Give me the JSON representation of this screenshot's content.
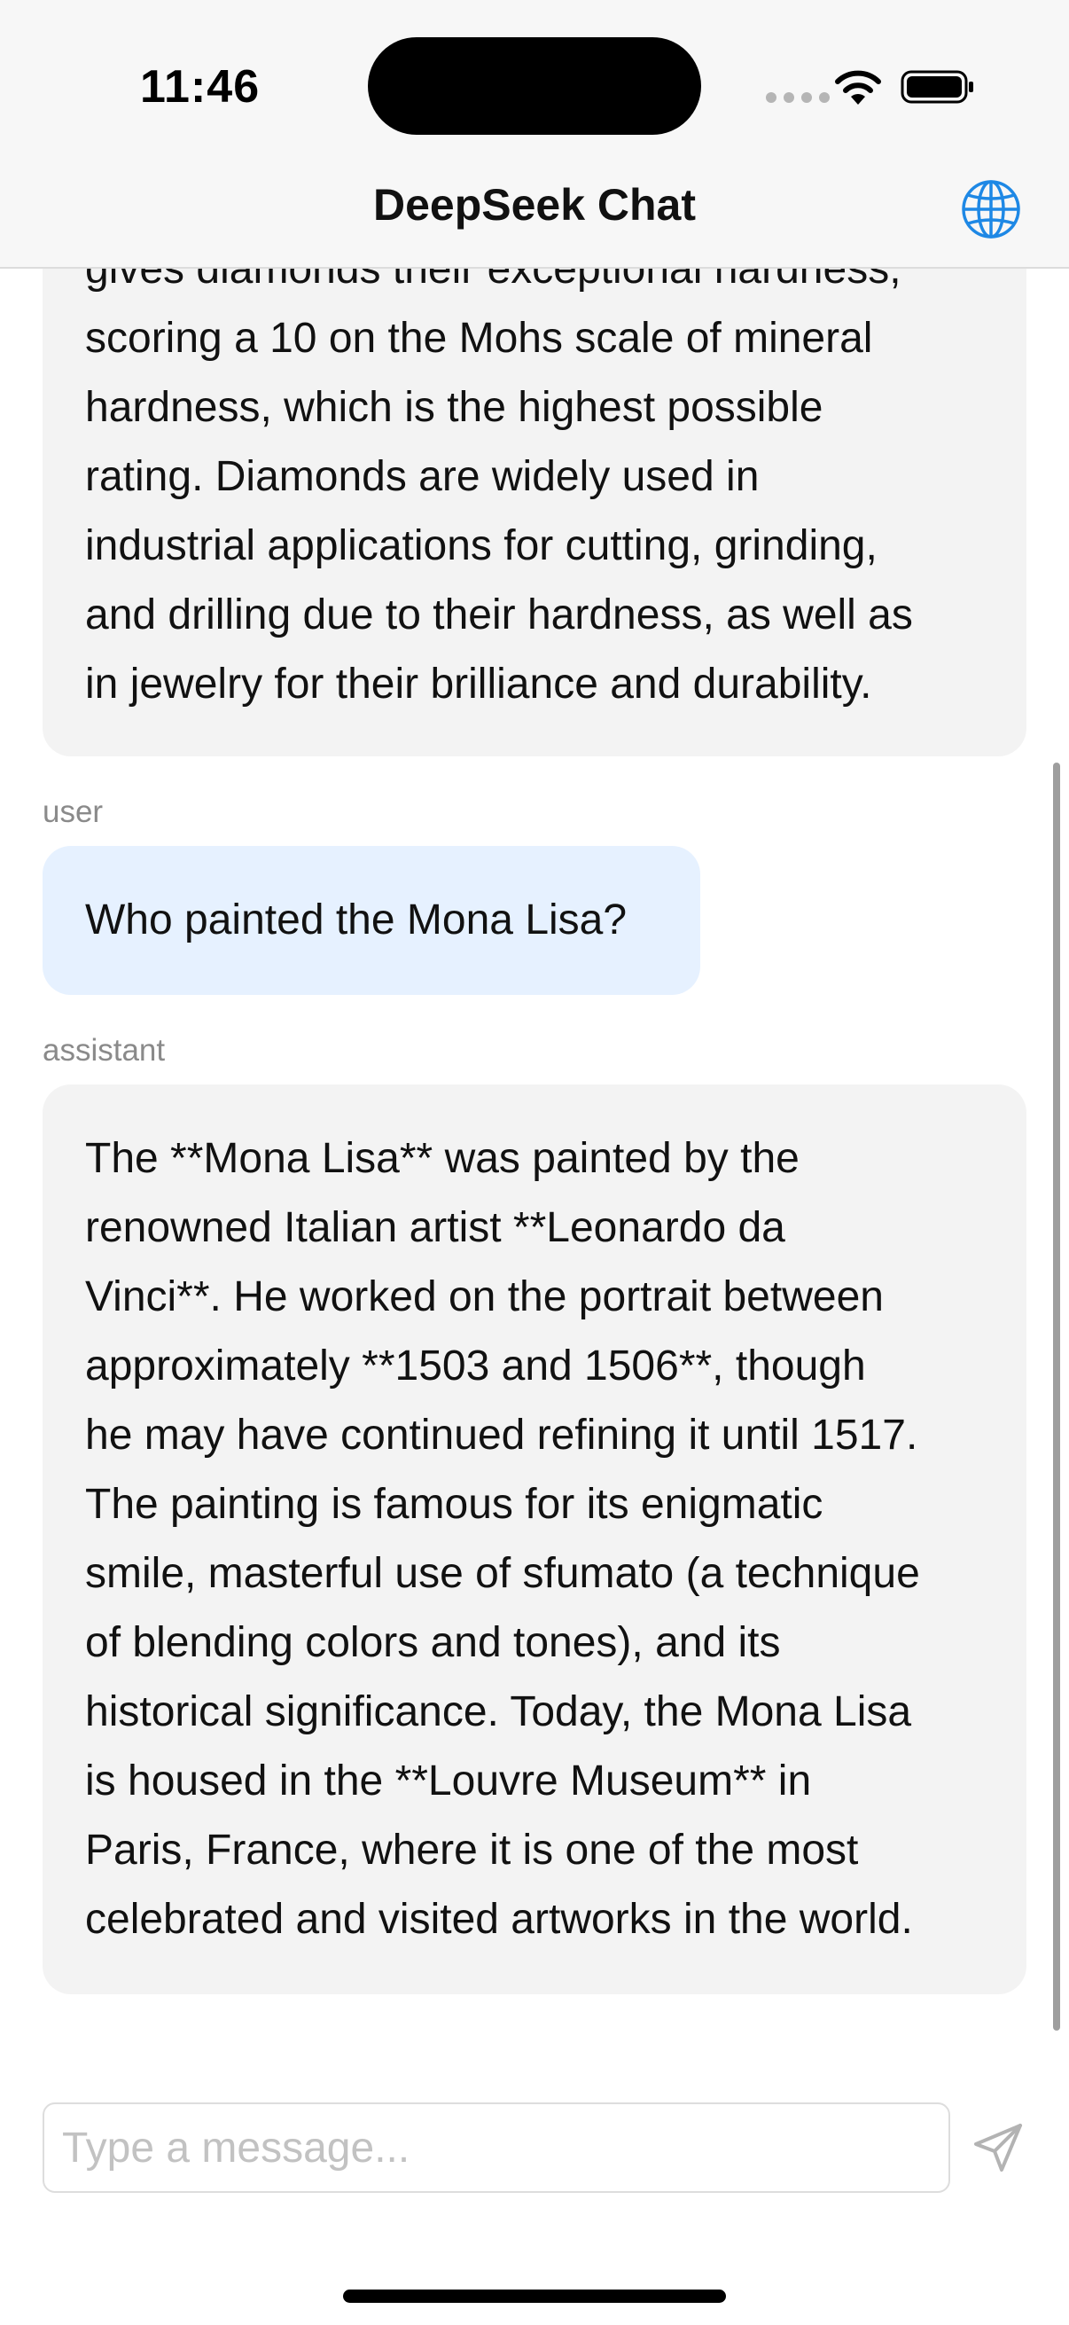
{
  "status_bar": {
    "time": "11:46"
  },
  "nav": {
    "title": "DeepSeek Chat",
    "globe_icon": "globe-icon"
  },
  "messages": [
    {
      "role": "",
      "lines": [
        "gives diamonds their exceptional hardness,",
        "scoring a 10 on the Mohs scale of mineral",
        "hardness, which is the highest possible",
        "rating. Diamonds are widely used in",
        "industrial applications for cutting, grinding,",
        "and drilling due to their hardness, as well as",
        "in jewelry for their brilliance and durability."
      ]
    },
    {
      "role": "user",
      "lines": [
        "Who painted the Mona Lisa?"
      ]
    },
    {
      "role": "assistant",
      "lines": [
        "The **Mona Lisa** was painted by the",
        "renowned Italian artist **Leonardo da",
        "Vinci**. He worked on the portrait between",
        "approximately **1503 and 1506**, though",
        "he may have continued refining it until 1517.",
        "The painting is famous for its enigmatic",
        "smile, masterful use of sfumato (a technique",
        "of blending colors and tones), and its",
        "historical significance. Today, the Mona Lisa",
        "is housed in the **Louvre Museum** in",
        "Paris, France, where it is one of the most",
        "celebrated and visited artworks in the world."
      ]
    }
  ],
  "input": {
    "placeholder": "Type a message...",
    "value": ""
  },
  "send_icon": "paper-plane-icon",
  "colors": {
    "accent": "#1e88e5",
    "user_bubble": "#e6f1ff",
    "assistant_bubble": "#f3f3f3",
    "header_bg": "#f7f7f7"
  }
}
